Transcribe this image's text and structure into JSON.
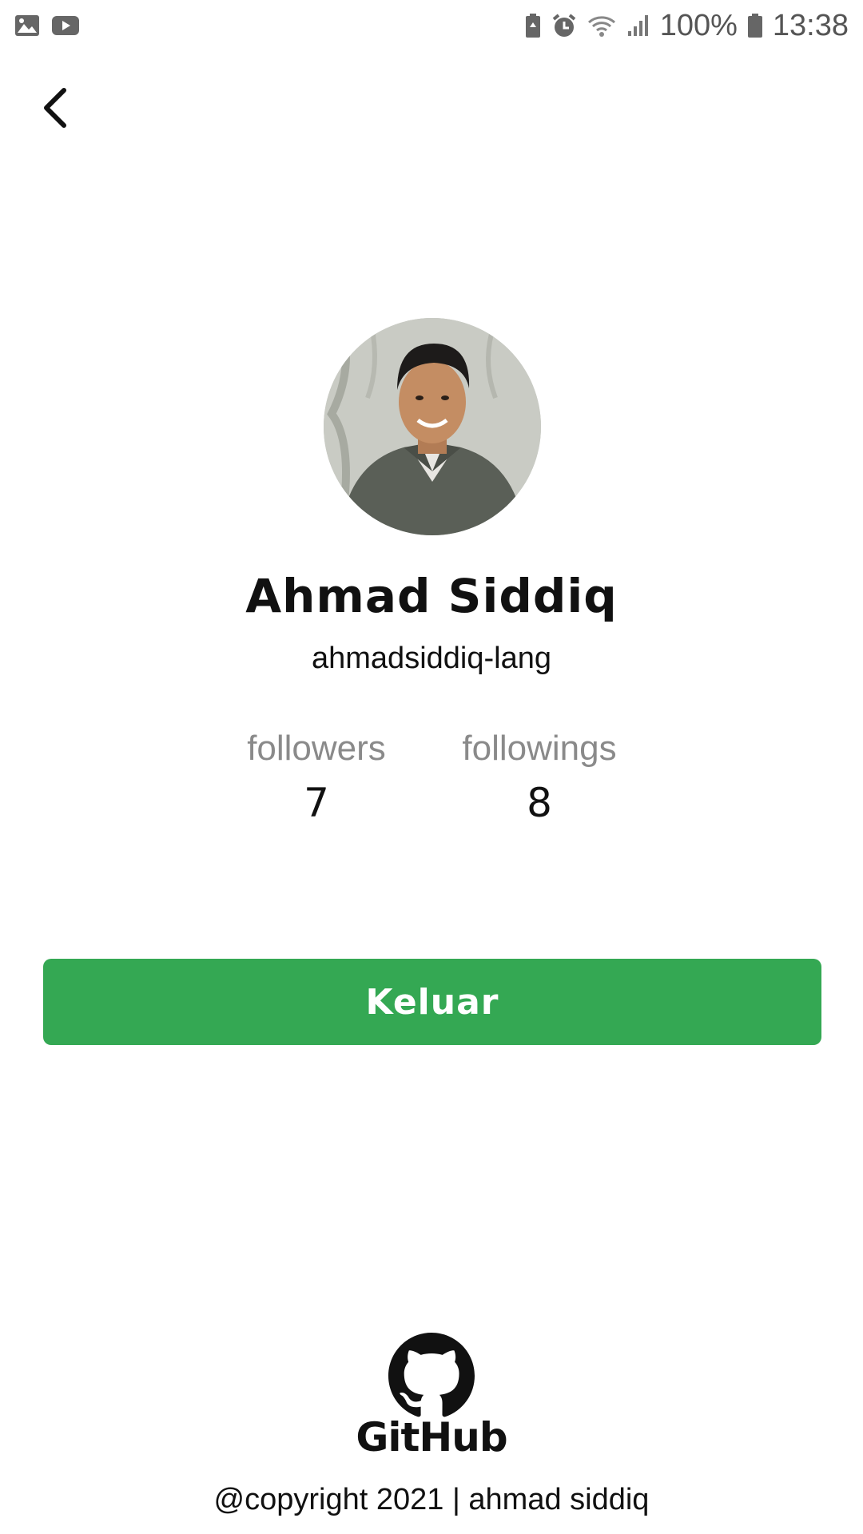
{
  "status_bar": {
    "battery": "100%",
    "time": "13:38",
    "icons_left": [
      "gallery-icon",
      "youtube-icon"
    ],
    "icons_right": [
      "battery-saver-icon",
      "alarm-icon",
      "wifi-icon",
      "signal-icon",
      "battery-icon"
    ]
  },
  "nav": {
    "back_icon": "chevron-left-icon"
  },
  "profile": {
    "name": "Ahmad Siddiq",
    "username": "ahmadsiddiq-lang",
    "avatar_icon": "profile-photo"
  },
  "stats": {
    "followers_label": "followers",
    "followers_value": "7",
    "followings_label": "followings",
    "followings_value": "8"
  },
  "actions": {
    "logout_label": "Keluar"
  },
  "brand": {
    "logo_text": "GitHub",
    "logo_icon": "github-mark-icon"
  },
  "footer": {
    "copyright": "@copyright 2021 | ahmad siddiq"
  },
  "colors": {
    "accent": "#34a853",
    "muted_text": "#8a8a8a",
    "text": "#111111",
    "background": "#ffffff"
  }
}
